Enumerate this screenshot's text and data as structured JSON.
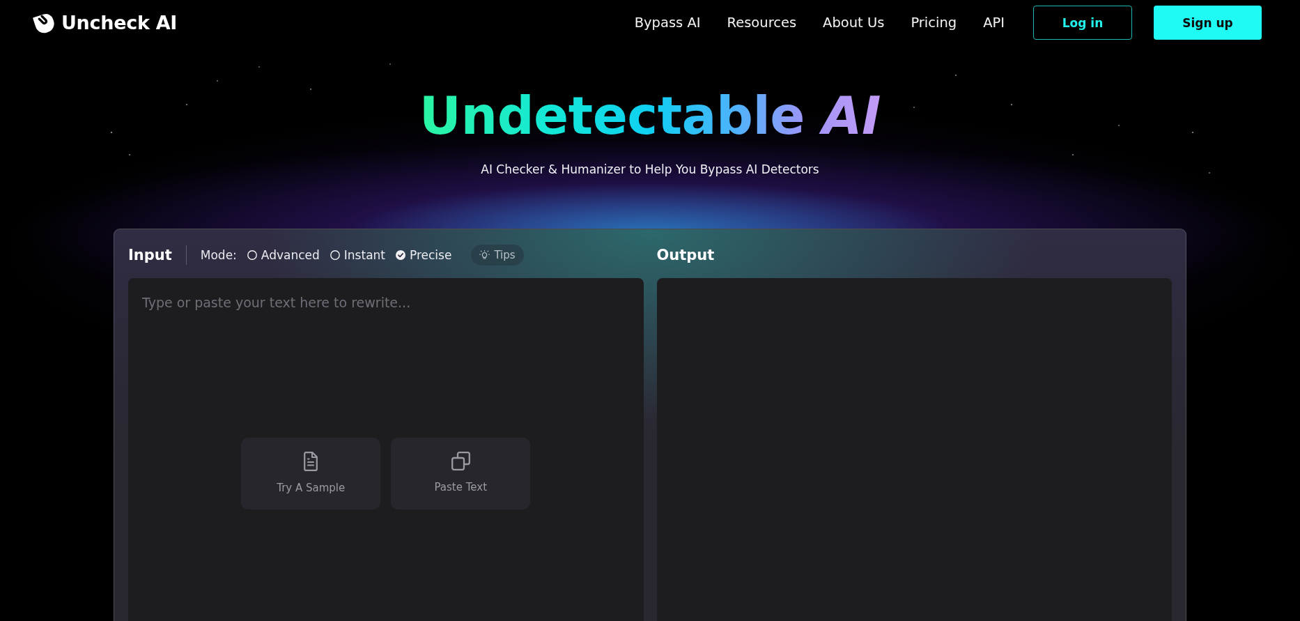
{
  "header": {
    "logo": "Uncheck AI",
    "nav": [
      "Bypass AI",
      "Resources",
      "About Us",
      "Pricing",
      "API"
    ],
    "buttons": [
      {
        "label": "Log in",
        "kind": "outline"
      },
      {
        "label": "Sign up",
        "kind": "filled"
      }
    ]
  },
  "hero": {
    "title": "Undetectable *AI*",
    "subtitle": "AI Checker & Humanizer to Help You Bypass AI Detectors"
  },
  "editor": {
    "input": {
      "title": "Input",
      "mode_label": "Mode:",
      "modes": [
        {
          "label": "Advanced",
          "selected": false
        },
        {
          "label": "Instant",
          "selected": false
        },
        {
          "label": "Precise",
          "selected": true
        }
      ],
      "tips": "Tips",
      "placeholder": "Type or paste your text here to rewrite...",
      "actions": [
        {
          "label": "Try A Sample",
          "kind": "sample"
        },
        {
          "label": "Paste Text",
          "kind": "paste"
        }
      ]
    },
    "output": {
      "title": "Output"
    }
  }
}
